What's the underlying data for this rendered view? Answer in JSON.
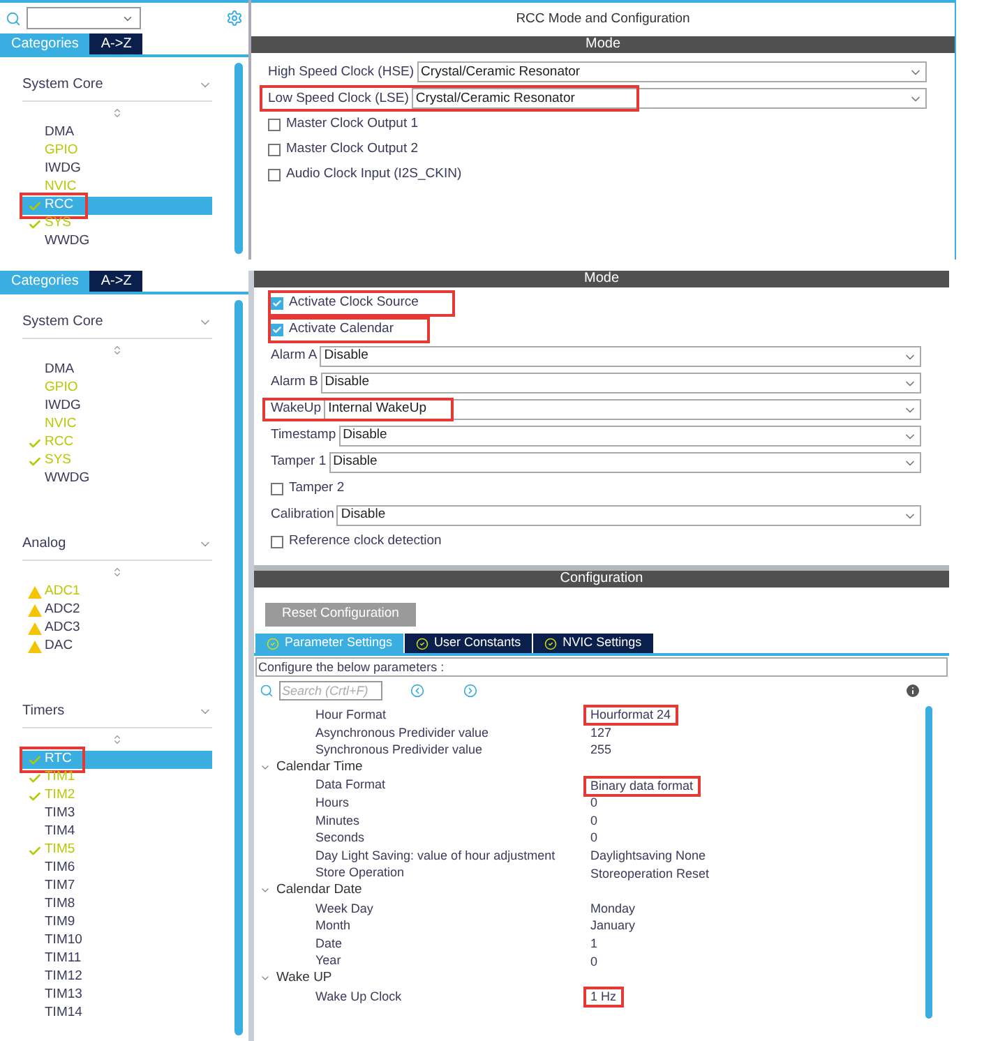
{
  "top": {
    "sidebar": {
      "tabs": [
        {
          "label": "Categories",
          "selected": true
        },
        {
          "label": "A->Z",
          "selected": false
        }
      ],
      "sections": [
        {
          "title": "System Core",
          "items": [
            {
              "label": "DMA",
              "kind": "plain",
              "available": false,
              "selected": false,
              "highlighted": false
            },
            {
              "label": "GPIO",
              "kind": "plain",
              "available": true,
              "selected": false,
              "highlighted": false
            },
            {
              "label": "IWDG",
              "kind": "plain",
              "available": false,
              "selected": false,
              "highlighted": false
            },
            {
              "label": "NVIC",
              "kind": "plain",
              "available": true,
              "selected": false,
              "highlighted": false
            },
            {
              "label": "RCC",
              "kind": "check",
              "selected": true,
              "highlighted": true
            },
            {
              "label": "SYS",
              "kind": "check",
              "available": true,
              "selected": false,
              "highlighted": false
            },
            {
              "label": "WWDG",
              "kind": "plain",
              "available": false,
              "selected": false,
              "highlighted": false
            }
          ]
        }
      ]
    },
    "panel": {
      "title": "RCC Mode and Configuration",
      "mode_header": "Mode",
      "fields": [
        {
          "kind": "select",
          "label": "High Speed Clock (HSE)",
          "value": "Crystal/Ceramic Resonator",
          "highlighted": false
        },
        {
          "kind": "select",
          "label": "Low Speed Clock (LSE)",
          "value": "Crystal/Ceramic Resonator",
          "highlighted": true
        },
        {
          "kind": "checkbox",
          "label": "Master Clock Output 1",
          "checked": false,
          "highlighted": false
        },
        {
          "kind": "checkbox",
          "label": "Master Clock Output 2",
          "checked": false,
          "highlighted": false
        },
        {
          "kind": "checkbox",
          "label": "Audio Clock Input (I2S_CKIN)",
          "checked": false,
          "highlighted": false
        }
      ]
    }
  },
  "bottom": {
    "sidebar": {
      "tabs": [
        {
          "label": "Categories",
          "selected": true
        },
        {
          "label": "A->Z",
          "selected": false
        }
      ],
      "sections": [
        {
          "title": "System Core",
          "items": [
            {
              "label": "DMA",
              "kind": "plain",
              "available": false,
              "selected": false,
              "highlighted": false
            },
            {
              "label": "GPIO",
              "kind": "plain",
              "available": true,
              "selected": false,
              "highlighted": false
            },
            {
              "label": "IWDG",
              "kind": "plain",
              "available": false,
              "selected": false,
              "highlighted": false
            },
            {
              "label": "NVIC",
              "kind": "plain",
              "available": true,
              "selected": false,
              "highlighted": false
            },
            {
              "label": "RCC",
              "kind": "check",
              "available": true,
              "selected": false,
              "highlighted": false
            },
            {
              "label": "SYS",
              "kind": "check",
              "available": true,
              "selected": false,
              "highlighted": false
            },
            {
              "label": "WWDG",
              "kind": "plain",
              "available": false,
              "selected": false,
              "highlighted": false
            }
          ]
        },
        {
          "title": "Analog",
          "items": [
            {
              "label": "ADC1",
              "kind": "warning",
              "available": true,
              "selected": false,
              "highlighted": false
            },
            {
              "label": "ADC2",
              "kind": "warning",
              "available": false,
              "selected": false,
              "highlighted": false
            },
            {
              "label": "ADC3",
              "kind": "warning",
              "available": false,
              "selected": false,
              "highlighted": false
            },
            {
              "label": "DAC",
              "kind": "warning",
              "available": false,
              "selected": false,
              "highlighted": false
            }
          ]
        },
        {
          "title": "Timers",
          "items": [
            {
              "label": "RTC",
              "kind": "check",
              "selected": true,
              "highlighted": true
            },
            {
              "label": "TIM1",
              "kind": "check",
              "available": true,
              "selected": false,
              "highlighted": false
            },
            {
              "label": "TIM2",
              "kind": "check",
              "available": true,
              "selected": false,
              "highlighted": false
            },
            {
              "label": "TIM3",
              "kind": "plain",
              "available": false,
              "selected": false,
              "highlighted": false
            },
            {
              "label": "TIM4",
              "kind": "plain",
              "available": false,
              "selected": false,
              "highlighted": false
            },
            {
              "label": "TIM5",
              "kind": "check",
              "available": true,
              "selected": false,
              "highlighted": false
            },
            {
              "label": "TIM6",
              "kind": "plain",
              "available": false,
              "selected": false,
              "highlighted": false
            },
            {
              "label": "TIM7",
              "kind": "plain",
              "available": false,
              "selected": false,
              "highlighted": false
            },
            {
              "label": "TIM8",
              "kind": "plain",
              "available": false,
              "selected": false,
              "highlighted": false
            },
            {
              "label": "TIM9",
              "kind": "plain",
              "available": false,
              "selected": false,
              "highlighted": false
            },
            {
              "label": "TIM10",
              "kind": "plain",
              "available": false,
              "selected": false,
              "highlighted": false
            },
            {
              "label": "TIM11",
              "kind": "plain",
              "available": false,
              "selected": false,
              "highlighted": false
            },
            {
              "label": "TIM12",
              "kind": "plain",
              "available": false,
              "selected": false,
              "highlighted": false
            },
            {
              "label": "TIM13",
              "kind": "plain",
              "available": false,
              "selected": false,
              "highlighted": false
            },
            {
              "label": "TIM14",
              "kind": "plain",
              "available": false,
              "selected": false,
              "highlighted": false
            }
          ]
        }
      ]
    },
    "mode": {
      "header": "Mode",
      "fields": [
        {
          "kind": "checkbox",
          "label": "Activate Clock Source",
          "checked": true,
          "highlighted": true
        },
        {
          "kind": "checkbox",
          "label": "Activate Calendar",
          "checked": true,
          "highlighted": true
        },
        {
          "kind": "select",
          "label": "Alarm A",
          "value": "Disable",
          "highlighted": false
        },
        {
          "kind": "select",
          "label": "Alarm B",
          "value": "Disable",
          "highlighted": false
        },
        {
          "kind": "select",
          "label": "WakeUp",
          "value": "Internal WakeUp",
          "highlighted": true
        },
        {
          "kind": "select",
          "label": "Timestamp",
          "value": "Disable",
          "highlighted": false
        },
        {
          "kind": "select",
          "label": "Tamper 1",
          "value": "Disable",
          "highlighted": false
        },
        {
          "kind": "checkbox",
          "label": "Tamper 2",
          "checked": false,
          "highlighted": false
        },
        {
          "kind": "select",
          "label": "Calibration",
          "value": "Disable",
          "highlighted": false
        },
        {
          "kind": "checkbox",
          "label": "Reference clock detection",
          "checked": false,
          "highlighted": false
        }
      ]
    },
    "configuration": {
      "header": "Configuration",
      "reset_button": "Reset Configuration",
      "tabs": [
        {
          "label": "Parameter Settings",
          "selected": true
        },
        {
          "label": "User Constants",
          "selected": false
        },
        {
          "label": "NVIC Settings",
          "selected": false
        }
      ],
      "hint": "Configure the below parameters :",
      "search_placeholder": "Search (Crtl+F)",
      "groups": [
        {
          "children": [
            {
              "label": "Hour Format",
              "value": "Hourformat 24",
              "highlighted": true
            },
            {
              "label": "Asynchronous Predivider value",
              "value": "127",
              "highlighted": false
            },
            {
              "label": "Synchronous Predivider value",
              "value": "255",
              "highlighted": false
            }
          ]
        },
        {
          "title": "Calendar Time",
          "expanded": true,
          "children": [
            {
              "label": "Data Format",
              "value": "Binary data format",
              "highlighted": true
            },
            {
              "label": "Hours",
              "value": "0",
              "highlighted": false
            },
            {
              "label": "Minutes",
              "value": "0",
              "highlighted": false
            },
            {
              "label": "Seconds",
              "value": "0",
              "highlighted": false
            },
            {
              "label": "Day Light Saving: value of hour adjustment",
              "value": "Daylightsaving None",
              "highlighted": false
            },
            {
              "label": "Store Operation",
              "value": "Storeoperation Reset",
              "highlighted": false
            }
          ]
        },
        {
          "title": "Calendar Date",
          "expanded": true,
          "children": [
            {
              "label": "Week Day",
              "value": "Monday",
              "highlighted": false
            },
            {
              "label": "Month",
              "value": "January",
              "highlighted": false
            },
            {
              "label": "Date",
              "value": "1",
              "highlighted": false
            },
            {
              "label": "Year",
              "value": "0",
              "highlighted": false
            }
          ]
        },
        {
          "title": "Wake UP",
          "expanded": true,
          "children": [
            {
              "label": "Wake Up Clock",
              "value": "1 Hz",
              "highlighted": true
            }
          ]
        }
      ]
    }
  }
}
